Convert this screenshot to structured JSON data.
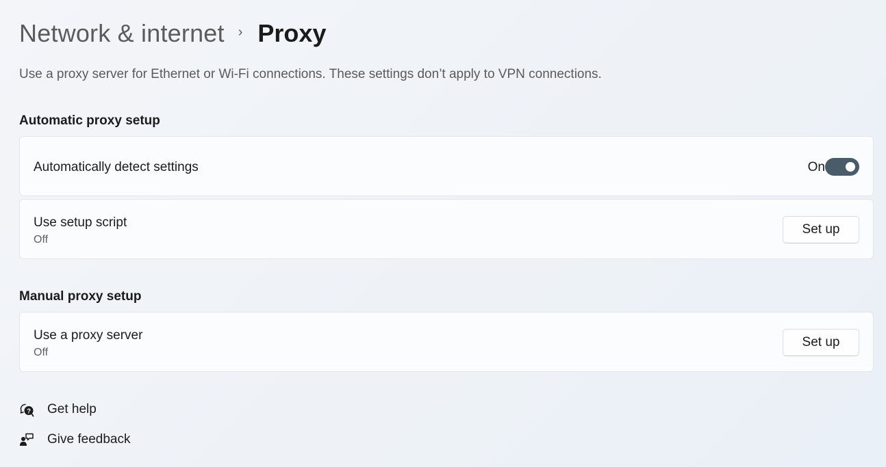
{
  "breadcrumb": {
    "parent": "Network & internet",
    "separator": "›",
    "current": "Proxy"
  },
  "description": "Use a proxy server for Ethernet or Wi-Fi connections. These settings don’t apply to VPN connections.",
  "automatic": {
    "heading": "Automatic proxy setup",
    "detect": {
      "title": "Automatically detect settings",
      "state_label": "On",
      "enabled": true
    },
    "script": {
      "title": "Use setup script",
      "status": "Off",
      "button_label": "Set up"
    }
  },
  "manual": {
    "heading": "Manual proxy setup",
    "proxy_server": {
      "title": "Use a proxy server",
      "status": "Off",
      "button_label": "Set up"
    }
  },
  "links": {
    "help": {
      "label": "Get help",
      "icon": "help-chat-icon"
    },
    "feedback": {
      "label": "Give feedback",
      "icon": "feedback-icon"
    }
  },
  "colors": {
    "toggle_on": "#4a5c6a",
    "card_background": "#fbfcfe"
  }
}
